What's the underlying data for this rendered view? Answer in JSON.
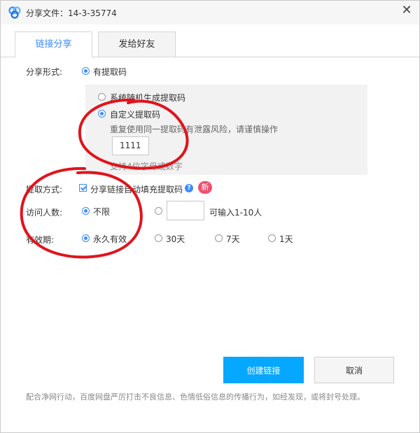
{
  "window": {
    "title": "分享文件：14-3-35774",
    "close_glyph": "✕"
  },
  "tabs": [
    {
      "label": "链接分享",
      "active": true
    },
    {
      "label": "发给好友",
      "active": false
    }
  ],
  "share_form": {
    "label": "分享形式:",
    "option": "有提取码",
    "selected": true
  },
  "code_panel": {
    "option_random": "系统随机生成提取码",
    "option_custom": "自定义提取码",
    "selected": "custom",
    "warning": "重复使用同一提取码有泄露风险，请谨慎操作",
    "code_value": "1111",
    "hint": "支持4位字母或数字"
  },
  "extract": {
    "label": "提取方式:",
    "checkbox_label": "分享链接自动填充提取码",
    "checked": true,
    "help_glyph": "?",
    "badge": "新"
  },
  "visitors": {
    "label": "访问人数:",
    "option_unlimited": "不限",
    "selected": "unlimited",
    "limit_hint": "可输入1-10人"
  },
  "validity": {
    "label": "有效期:",
    "options": [
      "永久有效",
      "30天",
      "7天",
      "1天"
    ],
    "selected_index": 0
  },
  "buttons": {
    "create": "创建链接",
    "cancel": "取消"
  },
  "footer_note": "配合净网行动，百度网盘严厉打击不良信息、色情低俗信息的传播行为，如经发现，或将封号处理。",
  "colors": {
    "accent": "#3b8cff",
    "primary_button": "#06a7ff",
    "annotation": "#e0141c",
    "badge": "#f0506e"
  }
}
